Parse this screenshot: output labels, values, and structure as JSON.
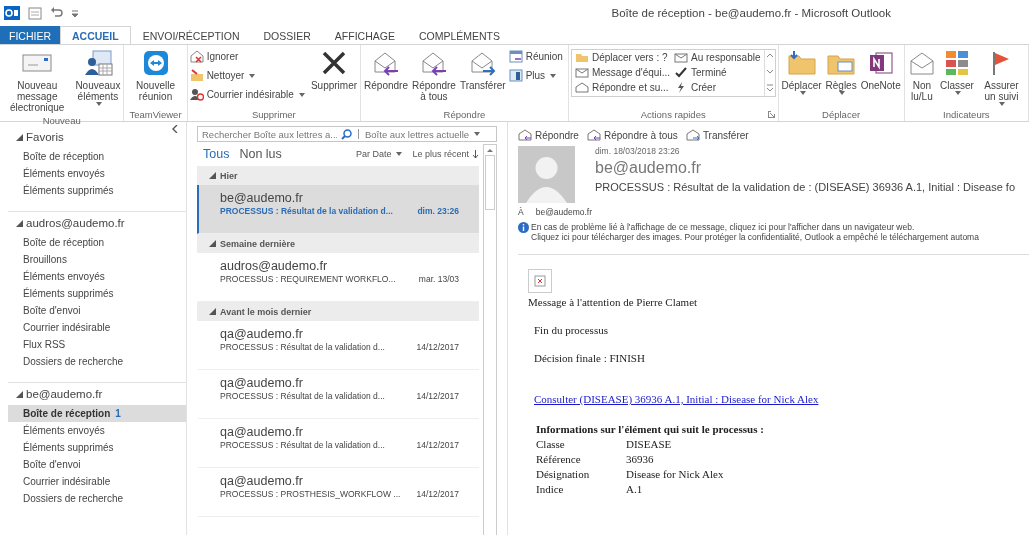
{
  "window": {
    "title": "Boîte de réception - be@audemo.fr - Microsoft Outlook"
  },
  "tabs": [
    {
      "label": "FICHIER",
      "kind": "file",
      "selected": false
    },
    {
      "label": "ACCUEIL",
      "kind": "tab",
      "selected": true
    },
    {
      "label": "ENVOI/RÉCEPTION",
      "kind": "tab",
      "selected": false
    },
    {
      "label": "DOSSIER",
      "kind": "tab",
      "selected": false
    },
    {
      "label": "AFFICHAGE",
      "kind": "tab",
      "selected": false
    },
    {
      "label": "COMPLÉMENTS",
      "kind": "tab",
      "selected": false
    }
  ],
  "ribbon": {
    "groups": [
      {
        "label": "Nouveau",
        "launcher": false,
        "items": [
          {
            "kind": "large",
            "label": "Nouveau message électronique",
            "dropdown": false
          },
          {
            "kind": "large",
            "label": "Nouveaux éléments",
            "dropdown": true
          }
        ]
      },
      {
        "label": "TeamViewer",
        "launcher": false,
        "items": [
          {
            "kind": "large",
            "label": "Nouvelle réunion",
            "dropdown": false
          }
        ]
      },
      {
        "label": "Supprimer",
        "launcher": false,
        "items": [
          {
            "kind": "small",
            "label": "Ignorer",
            "dropdown": false
          },
          {
            "kind": "small",
            "label": "Nettoyer",
            "dropdown": true
          },
          {
            "kind": "small",
            "label": "Courrier indésirable",
            "dropdown": true
          },
          {
            "kind": "large",
            "label": "Supprimer",
            "dropdown": false
          }
        ]
      },
      {
        "label": "Répondre",
        "launcher": false,
        "items": [
          {
            "kind": "large",
            "label": "Répondre",
            "dropdown": false
          },
          {
            "kind": "large",
            "label": "Répondre à tous",
            "dropdown": false
          },
          {
            "kind": "large",
            "label": "Transférer",
            "dropdown": false
          },
          {
            "kind": "small",
            "label": "Réunion",
            "dropdown": false
          },
          {
            "kind": "small",
            "label": "Plus",
            "dropdown": true
          }
        ]
      },
      {
        "label": "Actions rapides",
        "launcher": true,
        "items": [
          {
            "kind": "gallery",
            "entries": [
              "Déplacer vers : ?",
              "Message d'équi...",
              "Répondre et su...",
              "Au responsable",
              "Terminé",
              "Créer"
            ]
          }
        ]
      },
      {
        "label": "Déplacer",
        "launcher": false,
        "items": [
          {
            "kind": "large",
            "label": "Déplacer",
            "dropdown": true
          },
          {
            "kind": "large",
            "label": "Règles",
            "dropdown": true
          },
          {
            "kind": "large",
            "label": "OneNote",
            "dropdown": false
          }
        ]
      },
      {
        "label": "Indicateurs",
        "launcher": false,
        "items": [
          {
            "kind": "large",
            "label": "Non lu/Lu",
            "dropdown": false
          },
          {
            "kind": "large",
            "label": "Classer",
            "dropdown": true
          },
          {
            "kind": "large",
            "label": "Assurer un suivi",
            "dropdown": true
          }
        ]
      }
    ]
  },
  "folders": [
    {
      "label": "Favoris",
      "expanded": true,
      "children": [
        {
          "label": "Boîte de réception",
          "selected": false
        },
        {
          "label": "Éléments envoyés",
          "selected": false
        },
        {
          "label": "Éléments supprimés",
          "selected": false
        }
      ]
    },
    {
      "label": "audros@audemo.fr",
      "expanded": true,
      "children": [
        {
          "label": "Boîte de réception",
          "selected": false
        },
        {
          "label": "Brouillons",
          "selected": false
        },
        {
          "label": "Éléments envoyés",
          "selected": false
        },
        {
          "label": "Éléments supprimés",
          "selected": false
        },
        {
          "label": "Boîte d'envoi",
          "selected": false
        },
        {
          "label": "Courrier indésirable",
          "selected": false
        },
        {
          "label": "Flux RSS",
          "selected": false
        },
        {
          "label": "Dossiers de recherche",
          "selected": false
        }
      ]
    },
    {
      "label": "be@audemo.fr",
      "expanded": true,
      "children": [
        {
          "label": "Boîte de réception",
          "selected": true,
          "count": "1"
        },
        {
          "label": "Éléments envoyés",
          "selected": false
        },
        {
          "label": "Éléments supprimés",
          "selected": false
        },
        {
          "label": "Boîte d'envoi",
          "selected": false
        },
        {
          "label": "Courrier indésirable",
          "selected": false
        },
        {
          "label": "Dossiers de recherche",
          "selected": false
        }
      ]
    }
  ],
  "search": {
    "placeholder": "Rechercher Boîte aux lettres a...",
    "scope": "Boîte aux lettres actuelle"
  },
  "filters": [
    {
      "label": "Tous",
      "selected": true
    },
    {
      "label": "Non lus",
      "selected": false
    }
  ],
  "sort": {
    "field": "Par Date",
    "order": "Le plus récent"
  },
  "message_groups": [
    {
      "label": "Hier",
      "messages": [
        {
          "sender": "be@audemo.fr",
          "subject": "PROCESSUS : Résultat de la validation d...",
          "date": "dim. 23:26",
          "selected": true
        }
      ]
    },
    {
      "label": "Semaine dernière",
      "messages": [
        {
          "sender": "audros@audemo.fr",
          "subject": "PROCESSUS : REQUIREMENT WORKFLO...",
          "date": "mar. 13/03",
          "selected": false
        }
      ]
    },
    {
      "label": "Avant le mois dernier",
      "messages": [
        {
          "sender": "qa@audemo.fr",
          "subject": "PROCESSUS : Résultat de la validation d...",
          "date": "14/12/2017",
          "selected": false
        },
        {
          "sender": "qa@audemo.fr",
          "subject": "PROCESSUS : Résultat de la validation d...",
          "date": "14/12/2017",
          "selected": false
        },
        {
          "sender": "qa@audemo.fr",
          "subject": "PROCESSUS : Résultat de la validation d...",
          "date": "14/12/2017",
          "selected": false
        },
        {
          "sender": "qa@audemo.fr",
          "subject": "PROCESSUS : PROSTHESIS_WORKFLOW ...",
          "date": "14/12/2017",
          "selected": false
        }
      ]
    }
  ],
  "reading": {
    "actions": [
      "Répondre",
      "Répondre à tous",
      "Transférer"
    ],
    "date": "dim. 18/03/2018 23:26",
    "sender": "be@audemo.fr",
    "subject": "PROCESSUS : Résultat de la validation de : (DISEASE) 36936 A.1, Initial : Disease fo",
    "to_label": "À",
    "to": "be@audemo.fr",
    "info": [
      "En cas de problème lié à l'affichage de ce message, cliquez ici pour l'afficher dans un navigateur web.",
      "Cliquez ici pour télécharger des images. Pour protéger la confidentialité, Outlook a empêché le téléchargement automa"
    ],
    "body": {
      "greeting": "Message à l'attention de Pierre Clamet",
      "paragraphs": [
        "Fin du processus",
        "Décision finale : FINISH"
      ],
      "link": "Consulter (DISEASE) 36936 A.1, Initial : Disease for Nick Alex",
      "table_title": "Informations sur l'élément qui suit le processus :",
      "rows": [
        {
          "label": "Classe",
          "value": "DISEASE"
        },
        {
          "label": "Référence",
          "value": "36936"
        },
        {
          "label": "Désignation",
          "value": "Disease for Nick Alex"
        },
        {
          "label": "Indice",
          "value": "A.1"
        }
      ]
    }
  }
}
